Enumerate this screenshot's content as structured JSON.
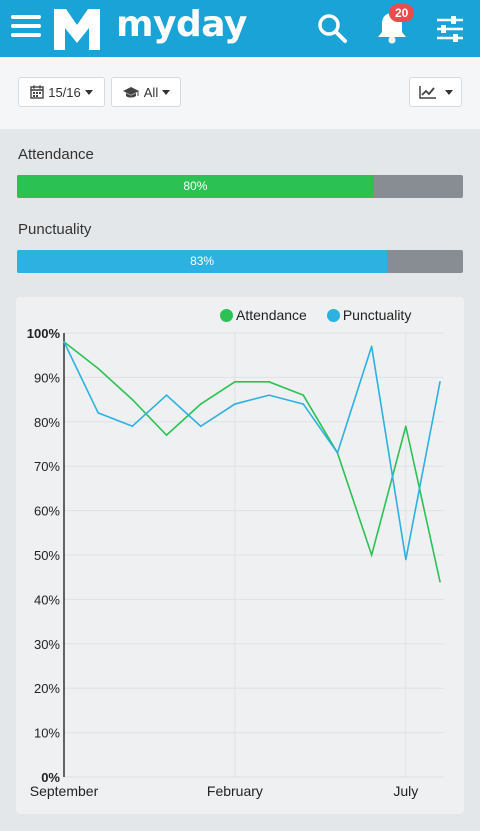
{
  "header": {
    "logo_text": "myday",
    "notification_count": "20",
    "colors": {
      "bar": "#1aa3d6",
      "badge": "#e84c4c"
    }
  },
  "toolbar": {
    "year_label": "15/16",
    "category_label": "All",
    "icons": {
      "year": "calendar-icon",
      "category": "graduation-cap-icon",
      "chart": "line-chart-icon"
    }
  },
  "progress": [
    {
      "label": "Attendance",
      "value_text": "80%",
      "value": 80,
      "color": "#2bc253"
    },
    {
      "label": "Punctuality",
      "value_text": "83%",
      "value": 83,
      "color": "#2cb1e0"
    }
  ],
  "chart_data": {
    "type": "line",
    "ylim": [
      0,
      100
    ],
    "yticks": [
      "0%",
      "10%",
      "20%",
      "30%",
      "40%",
      "50%",
      "60%",
      "70%",
      "80%",
      "90%",
      "100%"
    ],
    "x_labels": [
      {
        "label": "September",
        "index": 0
      },
      {
        "label": "February",
        "index": 5
      },
      {
        "label": "July",
        "index": 10
      }
    ],
    "x_count": 11,
    "grid": true,
    "legend_position": "top-right",
    "series": [
      {
        "name": "Attendance",
        "color": "#2bc253",
        "values": [
          98,
          92,
          85,
          77,
          84,
          89,
          89,
          86,
          73,
          50,
          79,
          44
        ]
      },
      {
        "name": "Punctuality",
        "color": "#2cb1e0",
        "values": [
          98,
          82,
          79,
          86,
          79,
          84,
          86,
          84,
          73,
          97,
          49,
          89
        ]
      }
    ]
  }
}
